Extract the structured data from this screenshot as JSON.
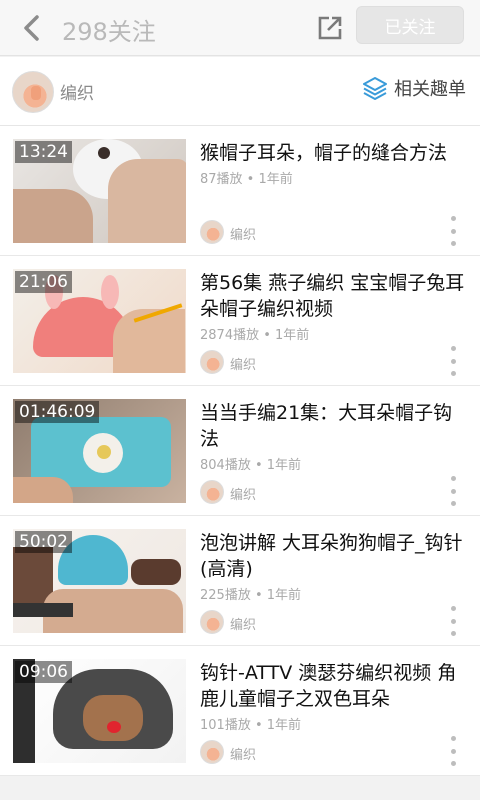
{
  "header": {
    "title": "298关注",
    "follow_button": "已关注"
  },
  "user": {
    "name": "编织",
    "related_label": "相关趣单"
  },
  "videos": [
    {
      "duration": "13:24",
      "title": "猴帽子耳朵，帽子的缝合方法",
      "meta": "87播放 • 1年前",
      "channel": "编织"
    },
    {
      "duration": "21:06",
      "title": "第56集 燕子编织 宝宝帽子兔耳朵帽子编织视频",
      "meta": "2874播放 • 1年前",
      "channel": "编织"
    },
    {
      "duration": "01:46:09",
      "title": "当当手编21集：大耳朵帽子钩法",
      "meta": "804播放 • 1年前",
      "channel": "编织"
    },
    {
      "duration": "50:02",
      "title": "泡泡讲解 大耳朵狗狗帽子_钩针(高清)",
      "meta": "225播放 • 1年前",
      "channel": "编织"
    },
    {
      "duration": "09:06",
      "title": "钩针-ATTV 澳瑟芬编织视频 角鹿儿童帽子之双色耳朵",
      "meta": "101播放 • 1年前",
      "channel": "编织"
    }
  ],
  "icons": {
    "back": "chevron-left-icon",
    "share": "share-icon",
    "layers": "layers-icon",
    "more": "more-vertical-icon"
  },
  "colors": {
    "accent": "#3a9bd9"
  }
}
